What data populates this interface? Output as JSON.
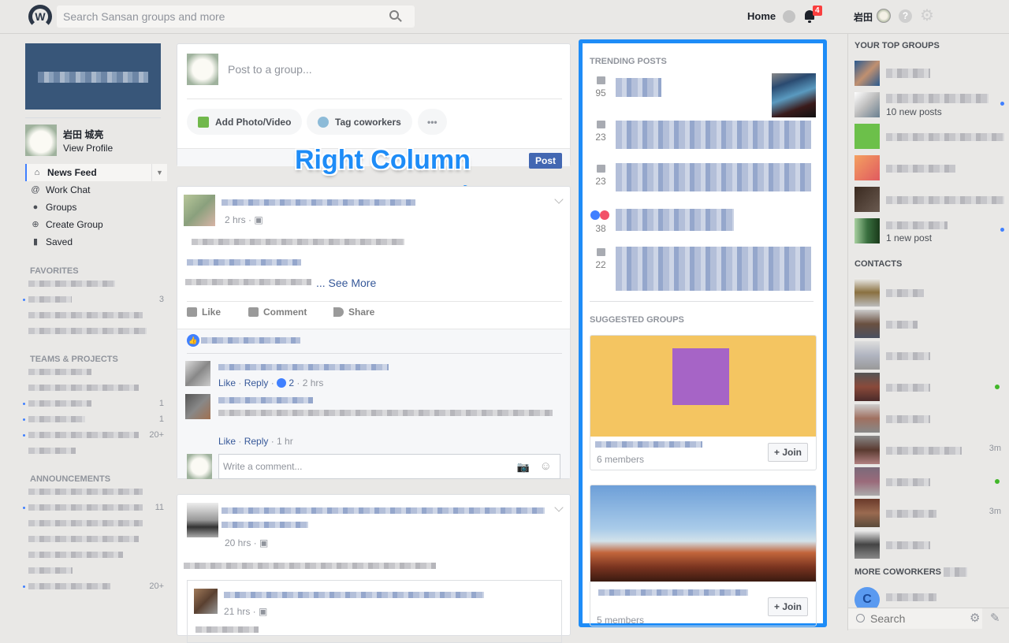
{
  "topbar": {
    "logo": "W",
    "search_placeholder": "Search Sansan groups and more",
    "home_label": "Home",
    "notification_count": "4",
    "user_short_name": "岩田",
    "help_label": "?"
  },
  "left_sidebar": {
    "profile_name": "岩田 城亮",
    "view_profile": "View Profile",
    "nav": [
      {
        "label": "News Feed",
        "icon": "home-icon",
        "active": true
      },
      {
        "label": "Work Chat",
        "icon": "work-chat-icon"
      },
      {
        "label": "Groups",
        "icon": "groups-icon"
      },
      {
        "label": "Create Group",
        "icon": "plus-circle-icon"
      },
      {
        "label": "Saved",
        "icon": "bookmark-icon"
      }
    ],
    "sections": [
      {
        "title": "FAVORITES",
        "counts": [
          "3"
        ]
      },
      {
        "title": "TEAMS & PROJECTS",
        "counts": [
          "1",
          "1",
          "20+"
        ]
      },
      {
        "title": "ANNOUNCEMENTS",
        "counts": [
          "11",
          "20+"
        ]
      }
    ]
  },
  "composer": {
    "placeholder": "Post to a group...",
    "add_photo": "Add Photo/Video",
    "tag_coworkers": "Tag coworkers",
    "more": "•••",
    "post_button": "Post"
  },
  "annotation": {
    "label": "Right Column",
    "accent": "#1e8cf7"
  },
  "feed": {
    "post1": {
      "time": "2 hrs ·",
      "see_more": "... See More",
      "actions": [
        "Like",
        "Comment",
        "Share"
      ],
      "comments": [
        {
          "like": "Like",
          "reply": "Reply",
          "reactions": "2",
          "time": "· 2 hrs"
        },
        {
          "like": "Like",
          "reply": "Reply",
          "time": "· 1 hr"
        }
      ],
      "comment_placeholder": "Write a comment..."
    },
    "post2": {
      "time": "20 hrs ·",
      "shared_time": "21 hrs ·"
    }
  },
  "right_column": {
    "trending_title": "TRENDING POSTS",
    "trending": [
      {
        "count": "95",
        "type": "comment"
      },
      {
        "count": "23",
        "type": "comment"
      },
      {
        "count": "23",
        "type": "comment"
      },
      {
        "count": "38",
        "type": "reaction"
      },
      {
        "count": "22",
        "type": "comment"
      }
    ],
    "suggested_title": "SUGGESTED GROUPS",
    "groups": [
      {
        "members": "6 members",
        "join": "+ Join"
      },
      {
        "members": "5 members",
        "join": "+ Join"
      }
    ]
  },
  "right_sidebar": {
    "top_groups_title": "YOUR TOP GROUPS",
    "top_groups": [
      {
        "sub": ""
      },
      {
        "sub": "10 new posts",
        "unread": true
      },
      {
        "sub": ""
      },
      {
        "sub": ""
      },
      {
        "sub": ""
      },
      {
        "sub": "1 new post",
        "unread": true
      }
    ],
    "contacts_title": "CONTACTS",
    "contacts": [
      {
        "status": ""
      },
      {
        "status": ""
      },
      {
        "status": ""
      },
      {
        "status": "online"
      },
      {
        "status": ""
      },
      {
        "status": "3m"
      },
      {
        "status": "online"
      },
      {
        "status": "3m"
      },
      {
        "status": ""
      }
    ],
    "more_coworkers_title": "MORE COWORKERS",
    "coworker_initial": "C",
    "chat_search_placeholder": "Search"
  }
}
